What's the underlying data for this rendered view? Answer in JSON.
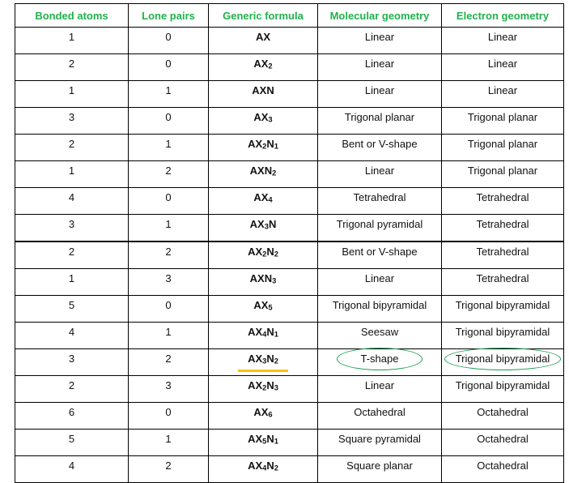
{
  "table": {
    "headers": [
      "Bonded atoms",
      "Lone pairs",
      "Generic formula",
      "Molecular geometry",
      "Electron geometry"
    ],
    "rows": [
      {
        "bonded": "1",
        "lone": "0",
        "formula": [
          [
            "AX",
            ""
          ]
        ],
        "molecular": "Linear",
        "electron": "Linear"
      },
      {
        "bonded": "2",
        "lone": "0",
        "formula": [
          [
            "AX",
            "2"
          ]
        ],
        "molecular": "Linear",
        "electron": "Linear"
      },
      {
        "bonded": "1",
        "lone": "1",
        "formula": [
          [
            "AXN",
            ""
          ]
        ],
        "molecular": "Linear",
        "electron": "Linear"
      },
      {
        "bonded": "3",
        "lone": "0",
        "formula": [
          [
            "AX",
            "3"
          ]
        ],
        "molecular": "Trigonal planar",
        "electron": "Trigonal planar"
      },
      {
        "bonded": "2",
        "lone": "1",
        "formula": [
          [
            "AX",
            "2"
          ],
          [
            "N",
            "1"
          ]
        ],
        "molecular": "Bent or V-shape",
        "electron": "Trigonal planar"
      },
      {
        "bonded": "1",
        "lone": "2",
        "formula": [
          [
            "AXN",
            "2"
          ]
        ],
        "molecular": "Linear",
        "electron": "Trigonal planar"
      },
      {
        "bonded": "4",
        "lone": "0",
        "formula": [
          [
            "AX",
            "4"
          ]
        ],
        "molecular": "Tetrahedral",
        "electron": "Tetrahedral"
      },
      {
        "bonded": "3",
        "lone": "1",
        "formula": [
          [
            "AX",
            "3"
          ],
          [
            "N",
            ""
          ]
        ],
        "molecular": "Trigonal pyramidal",
        "electron": "Tetrahedral"
      },
      {
        "bonded": "2",
        "lone": "2",
        "formula": [
          [
            "AX",
            "2"
          ],
          [
            "N",
            "2"
          ]
        ],
        "molecular": "Bent or V-shape",
        "electron": "Tetrahedral"
      },
      {
        "bonded": "1",
        "lone": "3",
        "formula": [
          [
            "AXN",
            "3"
          ]
        ],
        "molecular": "Linear",
        "electron": "Tetrahedral"
      },
      {
        "bonded": "5",
        "lone": "0",
        "formula": [
          [
            "AX",
            "5"
          ]
        ],
        "molecular": "Trigonal bipyramidal",
        "electron": "Trigonal bipyramidal"
      },
      {
        "bonded": "4",
        "lone": "1",
        "formula": [
          [
            "AX",
            "4"
          ],
          [
            "N",
            "1"
          ]
        ],
        "molecular": "Seesaw",
        "electron": "Trigonal bipyramidal"
      },
      {
        "bonded": "3",
        "lone": "2",
        "formula": [
          [
            "AX",
            "3"
          ],
          [
            "N",
            "2"
          ]
        ],
        "molecular": "T-shape",
        "electron": "Trigonal bipyramidal",
        "highlighted": true
      },
      {
        "bonded": "2",
        "lone": "3",
        "formula": [
          [
            "AX",
            "2"
          ],
          [
            "N",
            "3"
          ]
        ],
        "molecular": "Linear",
        "electron": "Trigonal bipyramidal"
      },
      {
        "bonded": "6",
        "lone": "0",
        "formula": [
          [
            "AX",
            "6"
          ]
        ],
        "molecular": "Octahedral",
        "electron": "Octahedral"
      },
      {
        "bonded": "5",
        "lone": "1",
        "formula": [
          [
            "AX",
            "5"
          ],
          [
            "N",
            "1"
          ]
        ],
        "molecular": "Square pyramidal",
        "electron": "Octahedral"
      },
      {
        "bonded": "4",
        "lone": "2",
        "formula": [
          [
            "AX",
            "4"
          ],
          [
            "N",
            "2"
          ]
        ],
        "molecular": "Square planar",
        "electron": "Octahedral"
      }
    ]
  },
  "colors": {
    "header_text": "#22b14c",
    "formula_text": "#c00000",
    "highlight_ellipse": "#1f9d55",
    "highlight_underline": "#ffc000"
  }
}
